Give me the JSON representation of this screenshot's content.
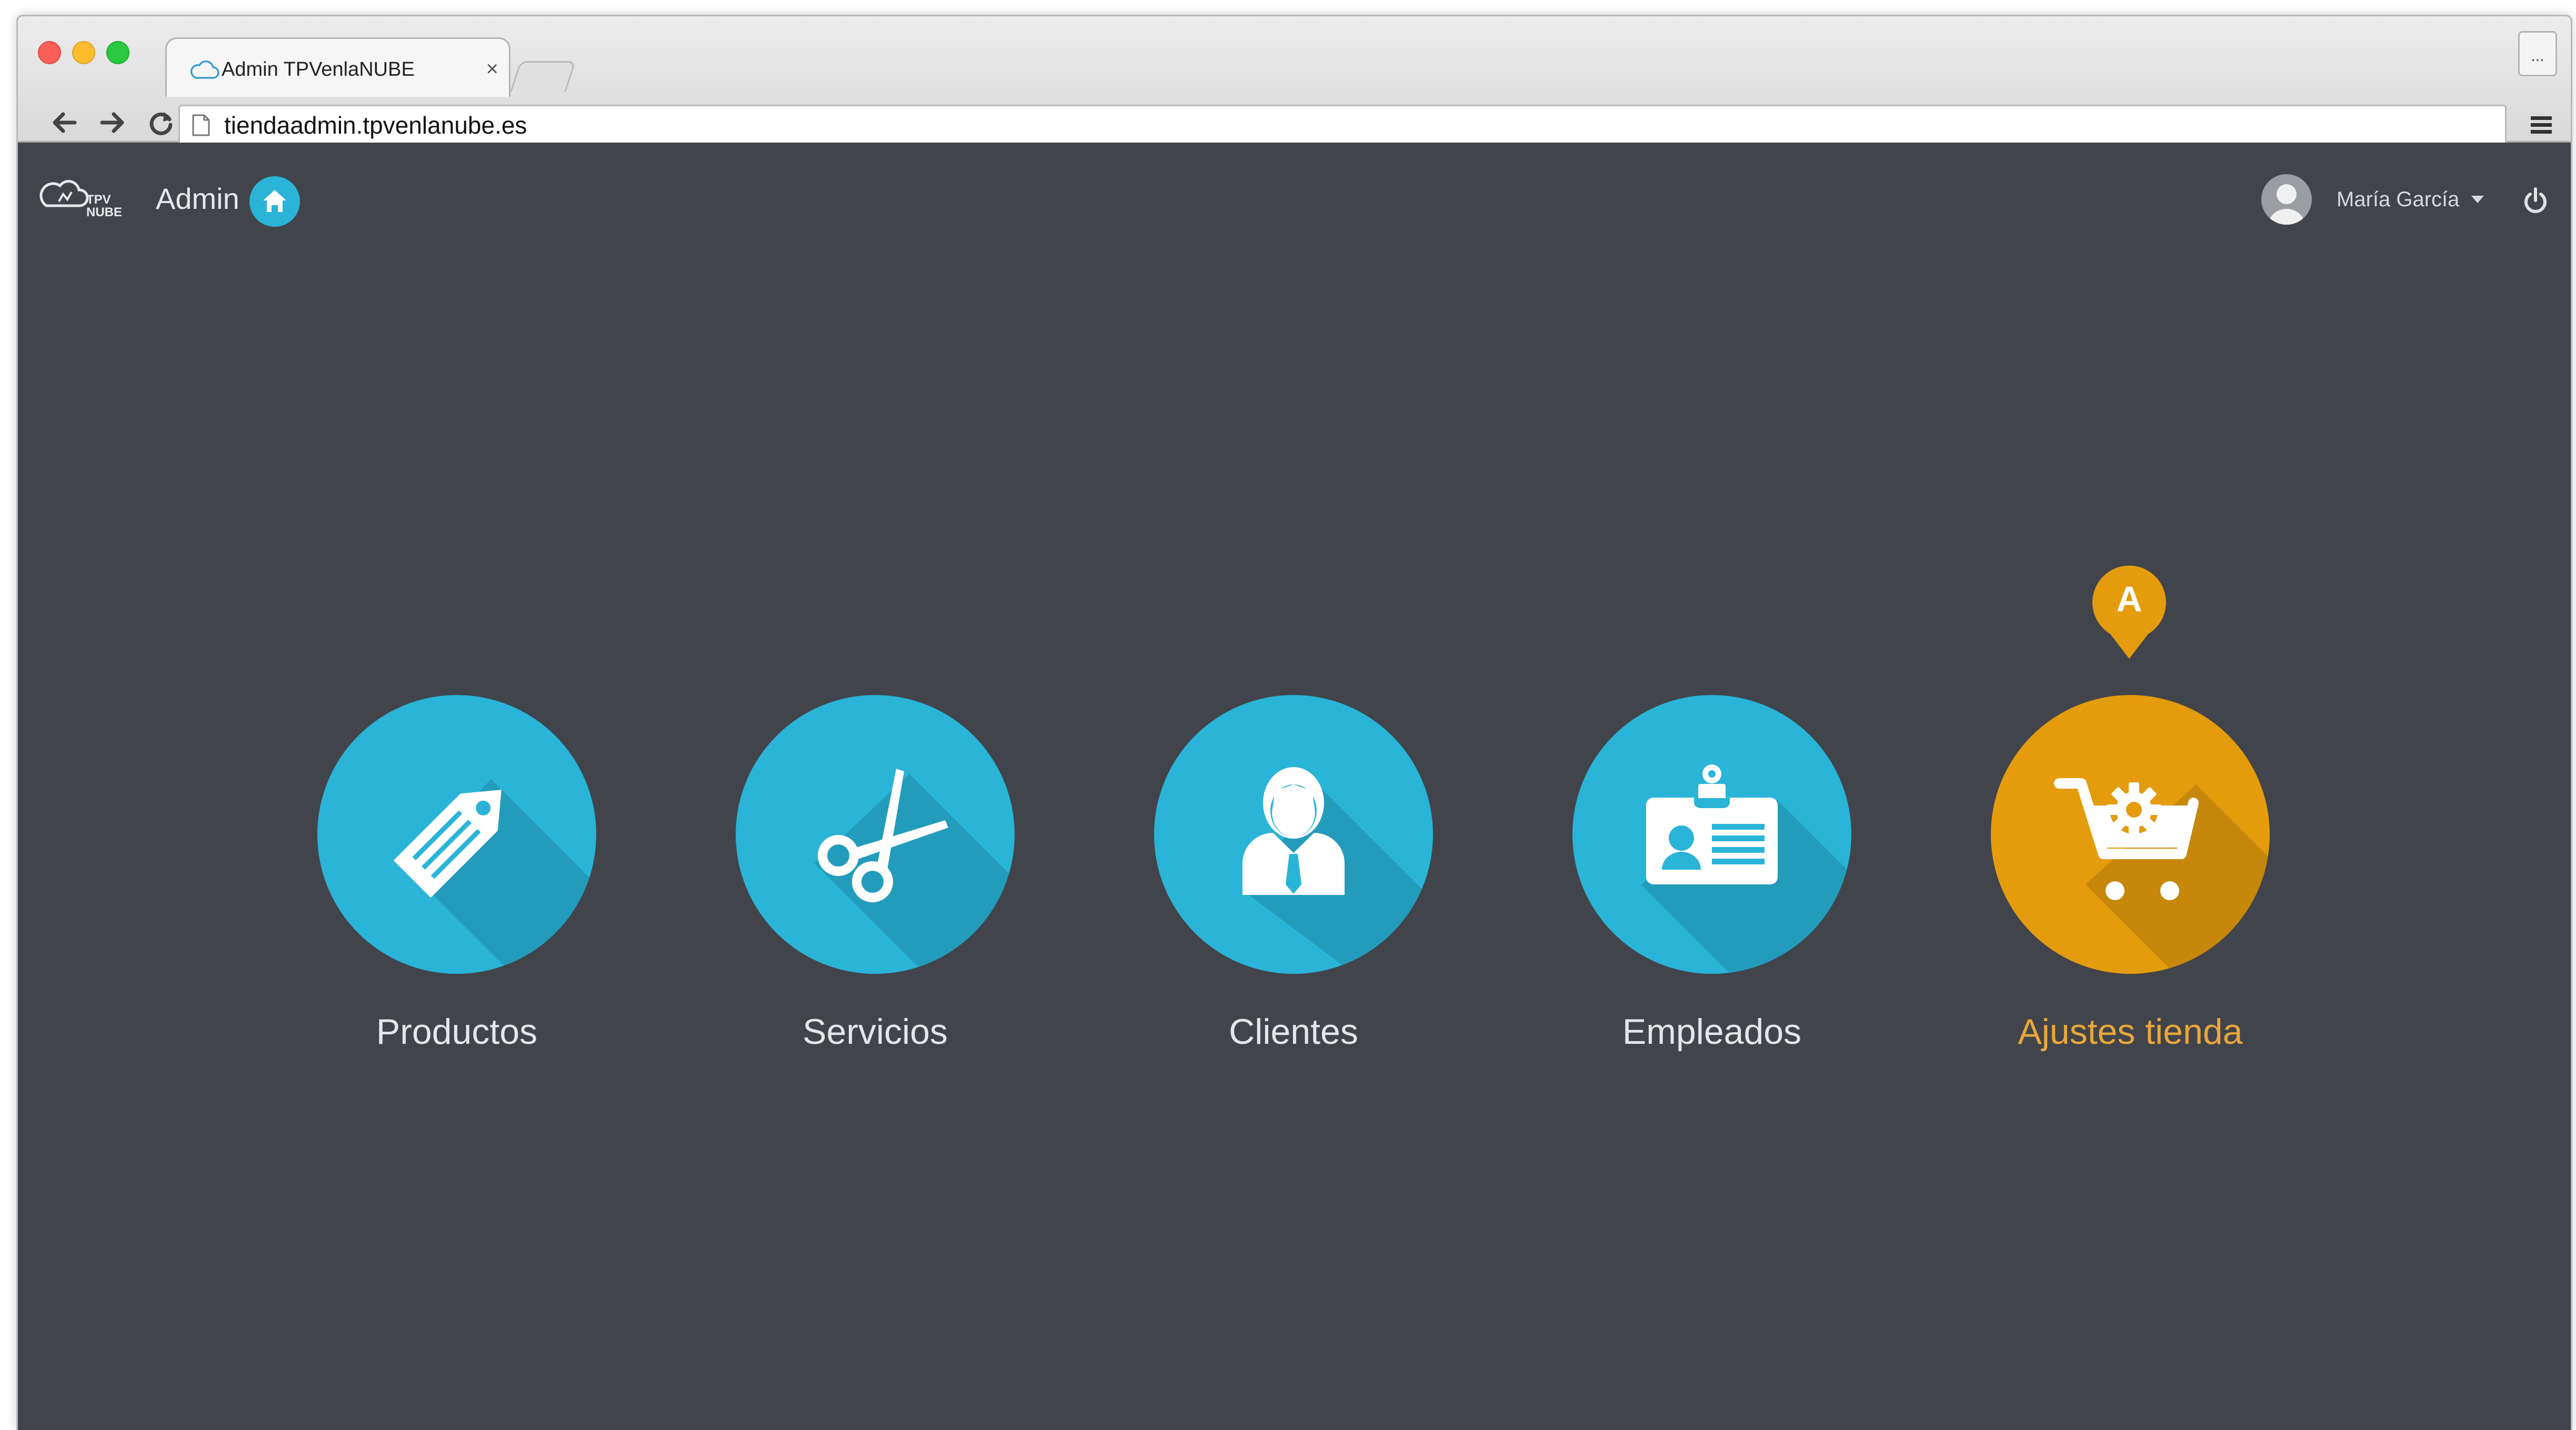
{
  "browser": {
    "tab_title": "Admin TPVenlaNUBE",
    "tab_close": "×",
    "overflow_label": "...",
    "url": "tiendaadmin.tpvenlanube.es"
  },
  "header": {
    "logo_text": "TPV NUBE",
    "app_label": "Admin",
    "user_name": "María García"
  },
  "marker": {
    "letter": "A"
  },
  "tiles": [
    {
      "label": "Productos",
      "icon": "price-tag-icon",
      "color": "#29b4d8",
      "active": false
    },
    {
      "label": "Servicios",
      "icon": "scissors-icon",
      "color": "#29b4d8",
      "active": false
    },
    {
      "label": "Clientes",
      "icon": "person-icon",
      "color": "#29b4d8",
      "active": false
    },
    {
      "label": "Empleados",
      "icon": "id-badge-icon",
      "color": "#29b4d8",
      "active": false
    },
    {
      "label": "Ajustes tienda",
      "icon": "cart-settings-icon",
      "color": "#e49b0c",
      "active": true
    }
  ],
  "colors": {
    "background": "#41454b",
    "tile_blue": "#29b4d8",
    "tile_orange": "#e49b0c",
    "active_label": "#e9a63a"
  }
}
